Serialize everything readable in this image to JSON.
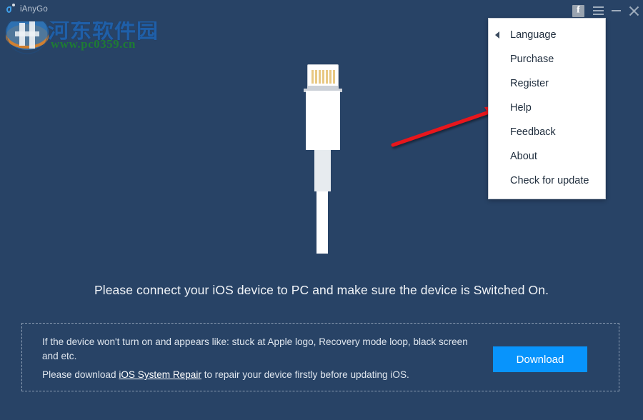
{
  "app": {
    "name": "iAnyGo",
    "background_color": "#284366"
  },
  "titlebar": {
    "brand_label": "iAnyGo",
    "buttons": {
      "facebook": "f",
      "facebook_name": "facebook-icon",
      "menu_name": "hamburger-menu-icon",
      "minimize_name": "minimize-icon",
      "close_name": "close-icon"
    }
  },
  "watermark": {
    "site_name_cn": "河东软件园",
    "site_url": "www.pc0359.cn",
    "cn_color": "#1f5fa8",
    "url_color": "#1e7b34"
  },
  "dropdown_menu": {
    "visible": true,
    "items": [
      {
        "label": "Language",
        "has_submenu_arrow": true
      },
      {
        "label": "Purchase",
        "has_submenu_arrow": false
      },
      {
        "label": "Register",
        "has_submenu_arrow": false
      },
      {
        "label": "Help",
        "has_submenu_arrow": false
      },
      {
        "label": "Feedback",
        "has_submenu_arrow": false
      },
      {
        "label": "About",
        "has_submenu_arrow": false
      },
      {
        "label": "Check for update",
        "has_submenu_arrow": false
      }
    ]
  },
  "illustration": {
    "name": "lightning-cable-illustration",
    "pin_count": 7,
    "pin_color": "#e8c884",
    "body_color": "#ffffff"
  },
  "annotation": {
    "name": "red-arrow-pointing-to-help",
    "color": "#e8161a",
    "points_to": "Help"
  },
  "main": {
    "instruction": "Please connect your iOS device to PC and make sure the device is Switched On."
  },
  "notice": {
    "line_1": "If the device won't turn on and appears like: stuck at Apple logo, Recovery mode loop, black screen and etc.",
    "line_2_before": "Please download ",
    "line_2_link": "iOS System Repair",
    "line_2_after": " to repair your device firstly before updating iOS.",
    "download_label": "Download",
    "download_color": "#0894fc"
  }
}
